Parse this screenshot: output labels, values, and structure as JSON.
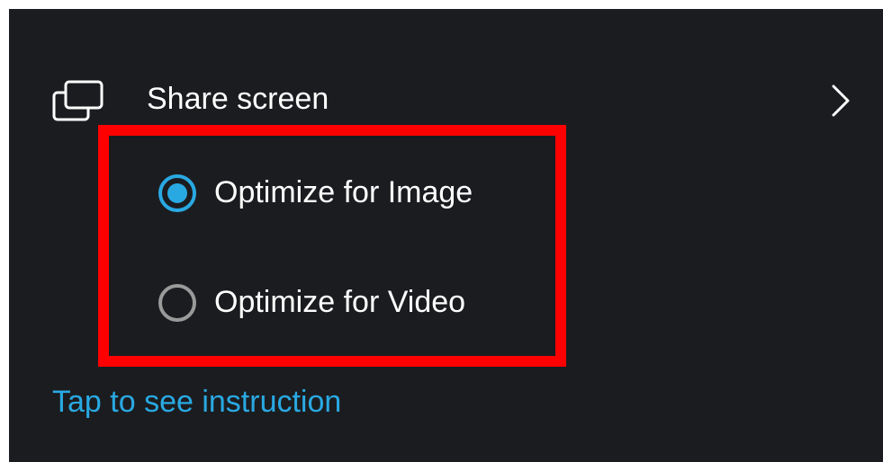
{
  "share_screen": {
    "icon": "share-screen-icon",
    "label": "Share screen",
    "chevron_icon": "chevron-right-icon"
  },
  "options": [
    {
      "label": "Optimize for Image",
      "selected": true
    },
    {
      "label": "Optimize for Video",
      "selected": false
    }
  ],
  "instruction_link": "Tap to see instruction",
  "colors": {
    "background": "#1b1c20",
    "accent": "#29a9e2",
    "highlight_border": "#ff0000",
    "radio_unselected": "#9a9a9a"
  }
}
